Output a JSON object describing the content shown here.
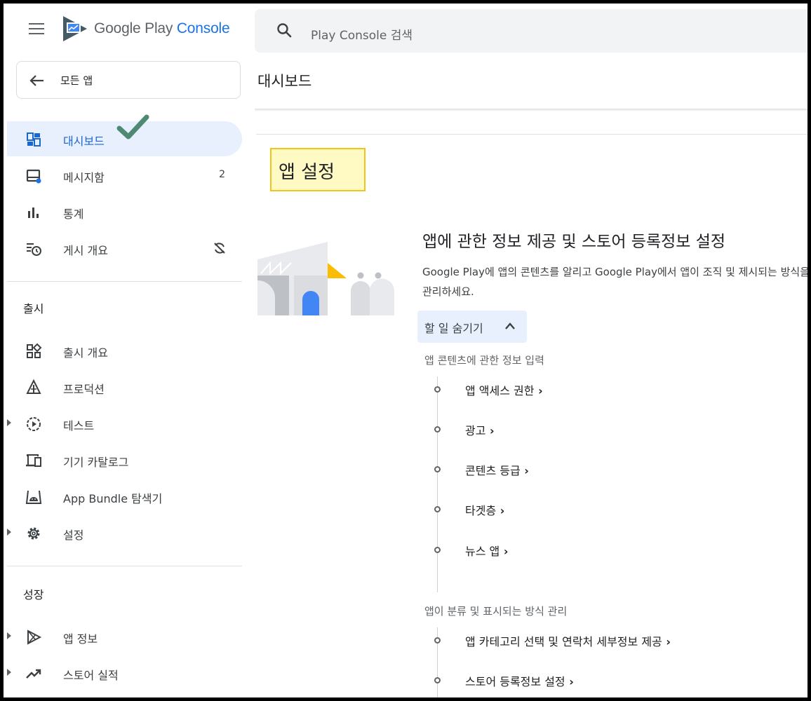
{
  "header": {
    "brand_main": "Google Play",
    "brand_accent": "Console",
    "search_placeholder": "Play Console 검색"
  },
  "sidebar": {
    "back_label": "모든 앱",
    "items": [
      {
        "label": "대시보드",
        "icon": "dashboard-icon",
        "active": true
      },
      {
        "label": "메시지함",
        "icon": "inbox-icon",
        "badge": "2"
      },
      {
        "label": "통계",
        "icon": "bar-chart-icon"
      },
      {
        "label": "게시 개요",
        "icon": "publishing-overview-icon",
        "trailing_icon": "sync-off-icon"
      }
    ],
    "release_section": {
      "title": "출시",
      "items": [
        {
          "label": "출시 개요",
          "icon": "release-overview-icon"
        },
        {
          "label": "프로덕션",
          "icon": "production-icon"
        },
        {
          "label": "테스트",
          "icon": "testing-icon",
          "expandable": true
        },
        {
          "label": "기기 카탈로그",
          "icon": "device-catalog-icon"
        },
        {
          "label": "App Bundle 탐색기",
          "icon": "android-icon"
        },
        {
          "label": "설정",
          "icon": "gear-icon",
          "expandable": true
        }
      ]
    },
    "growth_section": {
      "title": "성장",
      "items": [
        {
          "label": "앱 정보",
          "icon": "play-store-icon",
          "expandable": true
        },
        {
          "label": "스토어 실적",
          "icon": "trending-up-icon",
          "expandable": true
        }
      ]
    }
  },
  "main": {
    "page_title": "대시보드",
    "app_setup_label": "앱 설정",
    "card": {
      "title": "앱에 관한 정보 제공 및 스토어 등록정보 설정",
      "description": "Google Play에 앱의 콘텐츠를 알리고 Google Play에서 앱이 조직 및 제시되는 방식을 관리하세요.",
      "hide_tasks_label": "할 일 숨기기"
    },
    "task_groups": [
      {
        "title": "앱 콘텐츠에 관한 정보 입력",
        "tasks": [
          "앱 액세스 권한",
          "광고",
          "콘텐츠 등급",
          "타겟층",
          "뉴스 앱"
        ]
      },
      {
        "title": "앱이 분류 및 표시되는 방식 관리",
        "tasks": [
          "앱 카테고리 선택 및 연락처 세부정보 제공",
          "스토어 등록정보 설정"
        ]
      }
    ]
  },
  "colors": {
    "accent": "#1a73e8",
    "active_bg": "#e8f0fe",
    "highlight_bg": "#fff9c4",
    "highlight_border": "#f0c419",
    "check": "#4e8a73"
  }
}
